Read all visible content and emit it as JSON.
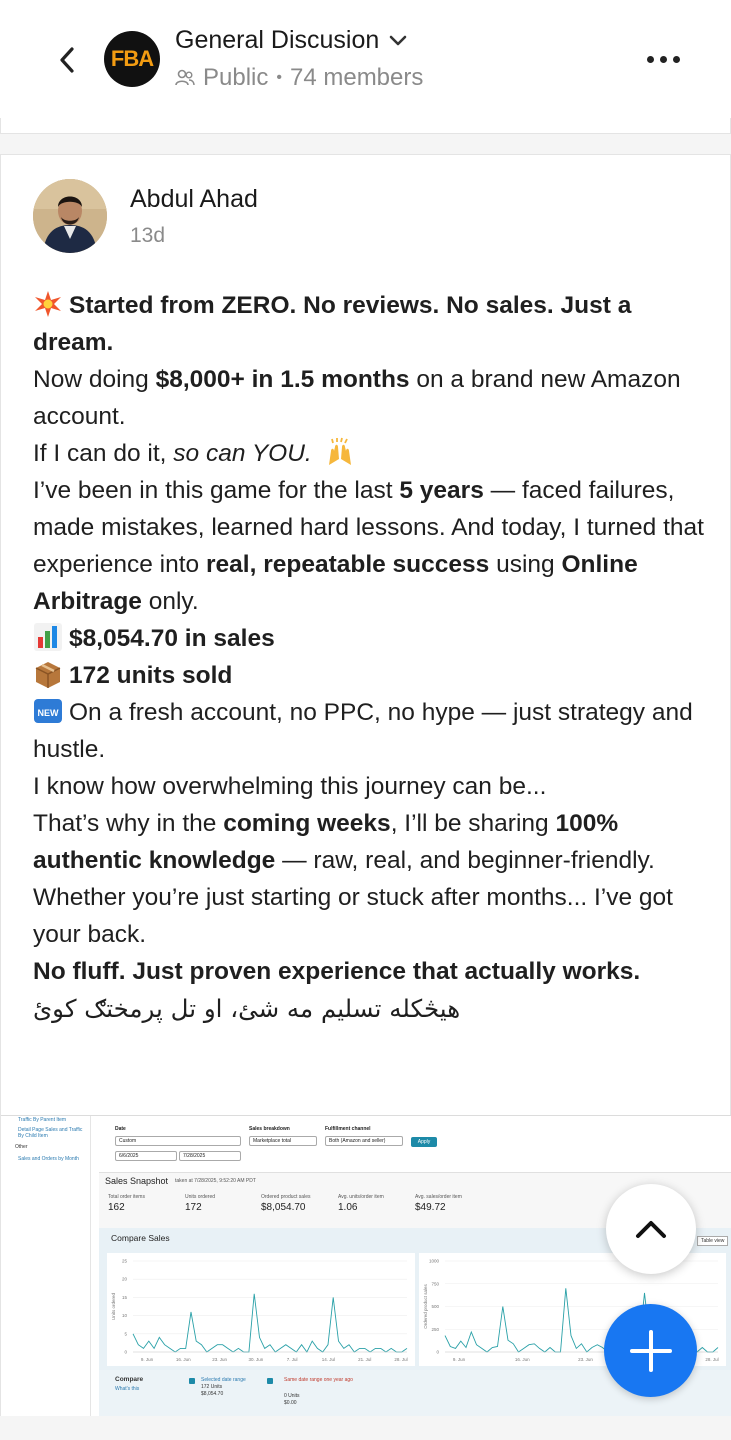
{
  "header": {
    "back_icon": "chevron-left-icon",
    "logo_text": "FBA",
    "group_name": "General Discusion",
    "visibility": "Public",
    "separator": "•",
    "members": "74 members",
    "more_icon": "more-horizontal-icon"
  },
  "post": {
    "author": "Abdul  Ahad",
    "time": "13d",
    "lines": {
      "l1_bold": "Started from ZERO. No reviews. No sales. Just a dream.",
      "l2_a": "Now doing ",
      "l2_b": "$8,000+ in 1.5 months",
      "l2_c": " on a brand new Amazon account.",
      "l3_a": "If I can do it, ",
      "l3_b": "so can YOU.",
      "l4_a": "I’ve been in this game for the last ",
      "l4_b": "5 years",
      "l4_c": " — faced failures, made mistakes, learned hard lessons. And today, I turned that experience into ",
      "l4_d": "real, repeatable success",
      "l4_e": " using ",
      "l4_f": "Online Arbitrage",
      "l4_g": " only.",
      "l5": "$8,054.70 in sales",
      "l6": "172 units sold",
      "l7": "On a fresh account, no PPC, no hype — just strategy and hustle.",
      "l8": "I know how overwhelming this journey can be...",
      "l9_a": "That’s why in the ",
      "l9_b": "coming weeks",
      "l9_c": ", I’ll be sharing ",
      "l9_d": "100% authentic knowledge",
      "l9_e": " — raw, real, and beginner-friendly.",
      "l10": "Whether you’re just starting or stuck after months... I’ve got your back.",
      "l11_bold": "No fluff. Just proven experience that actually works.",
      "l12_urdu": "هيڅکله تسليم مه شئ، او تل پرمختګ کوئ"
    }
  },
  "screenshot": {
    "sidebar": {
      "link1": "Traffic By Parent Item",
      "link2": "Detail Page Sales and Traffic By Child Item",
      "other": "Other",
      "link3": "Sales and Orders by Month"
    },
    "filters": {
      "date_label": "Date",
      "date_value": "Custom",
      "date_from": "6/6/2025",
      "date_to": "7/28/2025",
      "breakdown_label": "Sales breakdown",
      "breakdown_value": "Marketplace total",
      "channel_label": "Fulfillment channel",
      "channel_value": "Both (Amazon and seller)",
      "apply": "Apply"
    },
    "snapshot": {
      "title": "Sales Snapshot",
      "taken": "taken at 7/28/2025, 9:52:20 AM PDT",
      "metrics": [
        {
          "label": "Total order items",
          "value": "162"
        },
        {
          "label": "Units ordered",
          "value": "172"
        },
        {
          "label": "Ordered product sales",
          "value": "$8,054.70"
        },
        {
          "label": "Avg. units/order item",
          "value": "1.06"
        },
        {
          "label": "Avg. sales/order item",
          "value": "$49.72"
        }
      ]
    },
    "compare": {
      "title": "Compare Sales",
      "table_view": "Table view",
      "left_ylabel": "Units ordered",
      "right_ylabel": "Ordered product sales",
      "left_yticks": [
        "25",
        "20",
        "15",
        "10",
        "5",
        "0"
      ],
      "right_yticks": [
        "1000",
        "750",
        "500",
        "250",
        "0"
      ],
      "xticks_left": [
        "9. Jun",
        "16. Jun",
        "23. Jun",
        "30. Jun",
        "7. Jul",
        "14. Jul",
        "21. Jul",
        "28. Jul"
      ],
      "xticks_right": [
        "9. Jun",
        "16. Jun",
        "23. Jun",
        "30. Jun",
        "28. Jul"
      ],
      "compare_label": "Compare",
      "whats_this": "What's this",
      "selected_label": "Selected date range",
      "selected_units": "172 Units",
      "selected_sales": "$8,054.70",
      "prior_label": "Same date range one year ago",
      "prior_units": "0 Units",
      "prior_sales": "$0.00"
    },
    "units_series": [
      5,
      2,
      1,
      3,
      1,
      4,
      2,
      1,
      0,
      1,
      1,
      11,
      3,
      2,
      0,
      1,
      2,
      2,
      1,
      0,
      1,
      0,
      0,
      16,
      4,
      1,
      2,
      0,
      1,
      2,
      1,
      0,
      2,
      0,
      3,
      1,
      0,
      2,
      15,
      3,
      1,
      2,
      0,
      1,
      1,
      0,
      1,
      1,
      0,
      1,
      0,
      0,
      1
    ],
    "sales_series": [
      180,
      60,
      40,
      120,
      50,
      220,
      80,
      40,
      0,
      50,
      60,
      500,
      130,
      90,
      0,
      40,
      80,
      90,
      40,
      0,
      50,
      0,
      0,
      700,
      180,
      40,
      90,
      0,
      50,
      80,
      50,
      0,
      90,
      0,
      130,
      50,
      0,
      90,
      650,
      130,
      50,
      90,
      0,
      50,
      50,
      0,
      50,
      50,
      0,
      50,
      0,
      0,
      50
    ],
    "colors": {
      "series": "#2aa1a8",
      "accent": "#1d8aa8"
    }
  },
  "fab": {
    "up_icon": "chevron-up-icon",
    "add_icon": "plus-icon"
  }
}
